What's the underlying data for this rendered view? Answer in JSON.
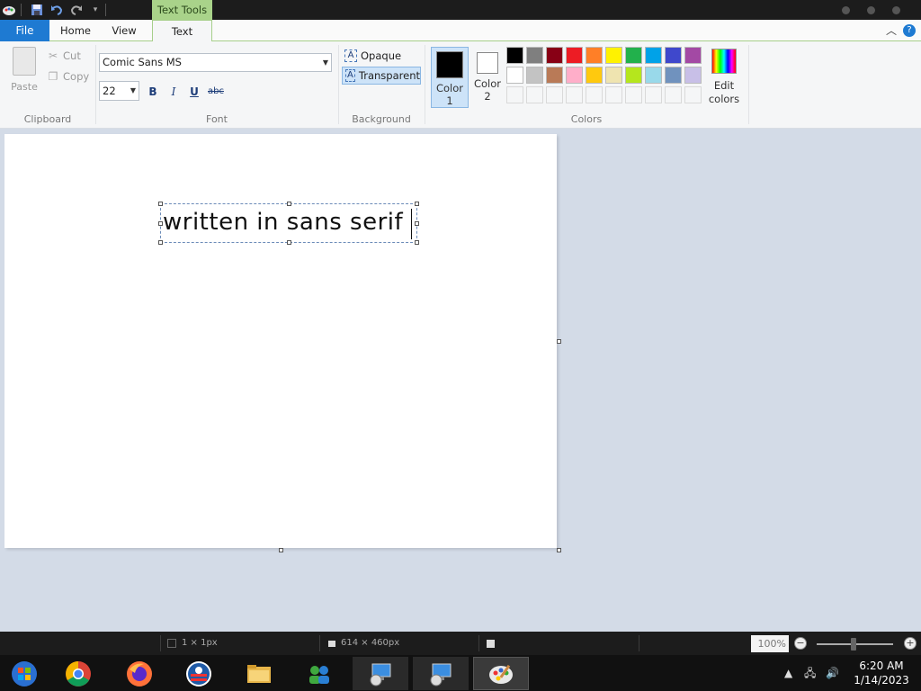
{
  "titlebar": {
    "context_tab": "Text Tools"
  },
  "tabs": {
    "file": "File",
    "home": "Home",
    "view": "View",
    "text": "Text"
  },
  "clipboard": {
    "paste": "Paste",
    "cut": "Cut",
    "copy": "Copy",
    "group": "Clipboard"
  },
  "font": {
    "family": "Comic Sans MS",
    "size": "22",
    "bold": "B",
    "italic": "I",
    "underline": "U",
    "strike": "abc",
    "group": "Font"
  },
  "background": {
    "opaque": "Opaque",
    "transparent": "Transparent",
    "group": "Background"
  },
  "colors": {
    "color1_line1": "Color",
    "color1_line2": "1",
    "color2_line1": "Color",
    "color2_line2": "2",
    "edit_line1": "Edit",
    "edit_line2": "colors",
    "group": "Colors",
    "color1_value": "#000000",
    "color2_value": "#ffffff",
    "row1": [
      "#000000",
      "#7f7f7f",
      "#880015",
      "#ed1c24",
      "#ff7f27",
      "#fff200",
      "#22b14c",
      "#00a2e8",
      "#3f48cc",
      "#a349a4"
    ],
    "row2": [
      "#ffffff",
      "#c3c3c3",
      "#b97a57",
      "#ffaec9",
      "#ffc90e",
      "#efe4b0",
      "#b5e61d",
      "#99d9ea",
      "#7092be",
      "#c8bfe7"
    ]
  },
  "canvas": {
    "text": "written in sans serif"
  },
  "status": {
    "cursor_pos": "1 × 1px",
    "canvas_size": "614 × 460px",
    "zoom": "100%"
  },
  "taskbar": {
    "time": "6:20 AM",
    "date": "1/14/2023"
  }
}
